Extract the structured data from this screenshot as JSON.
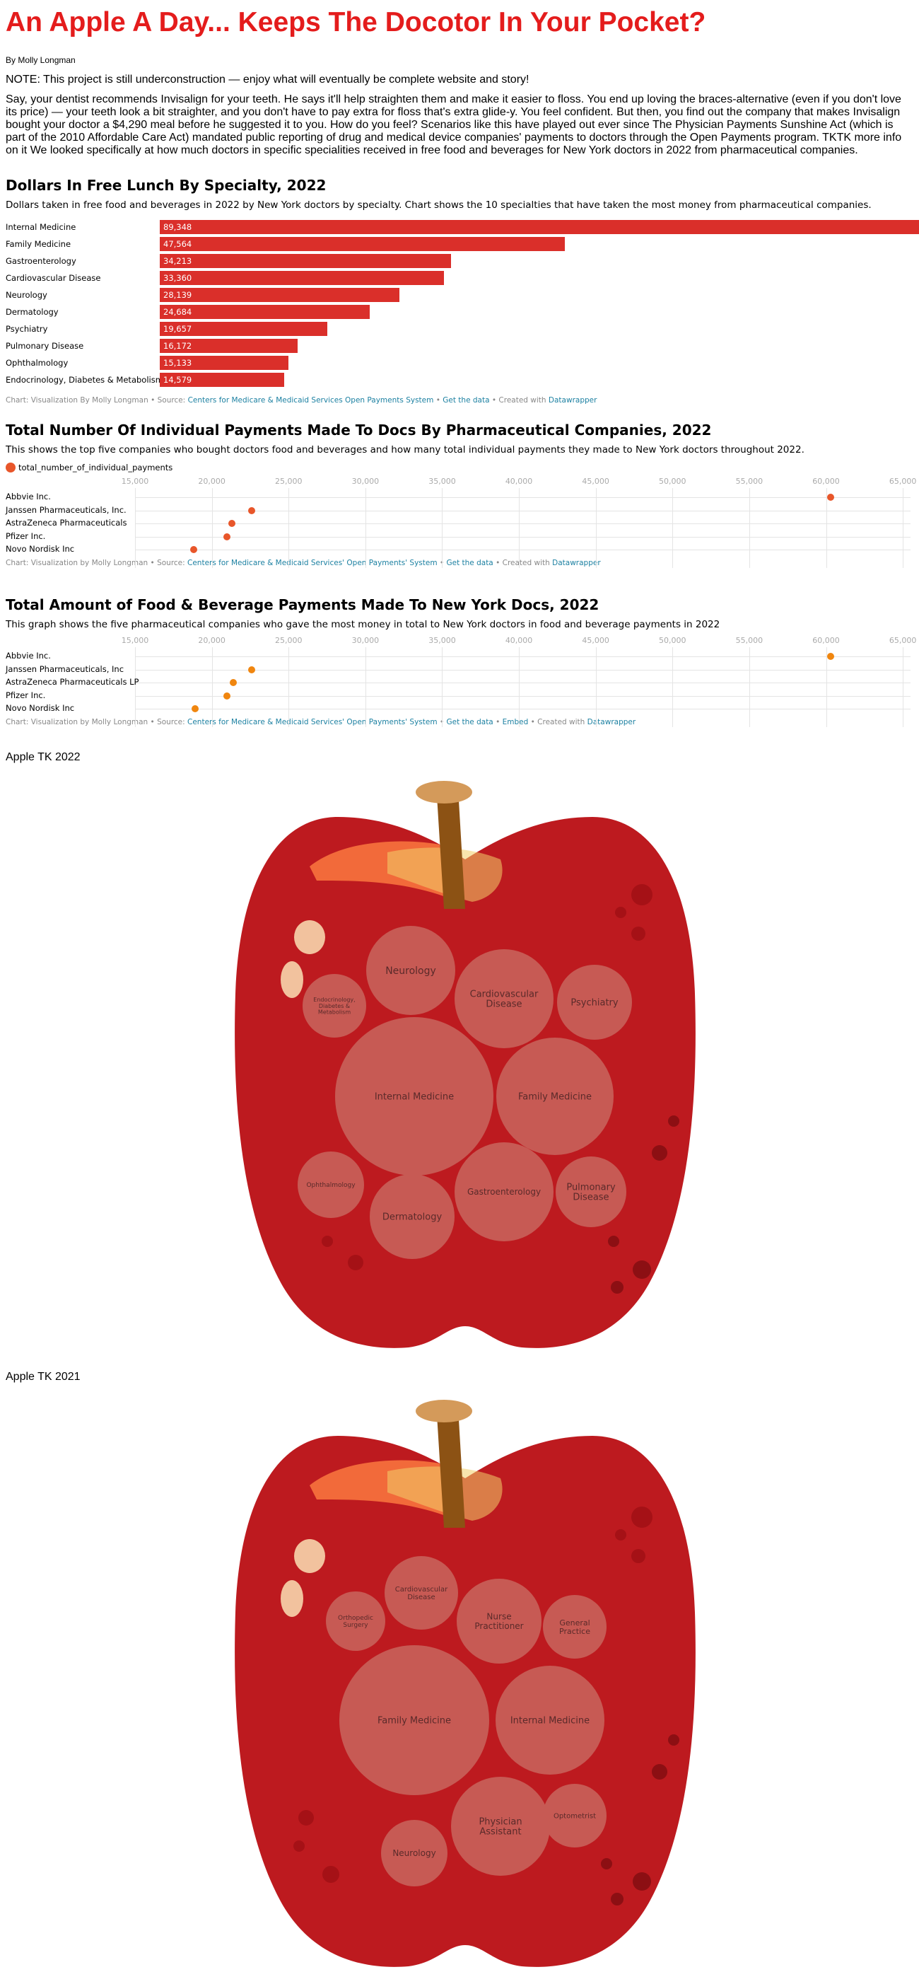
{
  "header": {
    "title": "An Apple A Day... Keeps The Docotor In Your Pocket?",
    "byline": "By Molly Longman",
    "note": "NOTE: This project is still underconstruction — enjoy what will eventually be complete website and story!",
    "intro": "Say, your dentist recommends Invisalign for your teeth. He says it'll help straighten them and make it easier to floss. You end up loving the braces-alternative (even if you don't love its price) — your teeth look a bit straighter, and you don't have to pay extra for floss that's extra glide-y. You feel confident. But then, you find out the company that makes Invisalign bought your doctor a $4,290 meal before he suggested it to you. How do you feel? Scenarios like this have played out ever since The Physician Payments Sunshine Act (which is part of the 2010 Affordable Care Act) mandated public reporting of drug and medical device companies' payments to doctors through the Open Payments program. TKTK more info on it We looked specifically at how much doctors in specific specialities received in free food and beverages for New York doctors in 2022 from pharmaceutical companies."
  },
  "colors": {
    "title_red": "#e41c1c",
    "bar_red": "#da2f2a",
    "dot_orange_red": "#e8562a",
    "dot_orange": "#f0860f",
    "link_blue": "#1d81a2",
    "apple_red": "#bd1a1f",
    "bubble": "#c75a54"
  },
  "chart_data": [
    {
      "type": "bar",
      "title": "Dollars In Free Lunch By Specialty, 2022",
      "subtitle": "Dollars taken in free food and beverages in 2022 by New York doctors by specialty. Chart shows the 10 specialties that have taken the most money from pharmaceutical companies.",
      "categories": [
        "Internal Medicine",
        "Family Medicine",
        "Gastroenterology",
        "Cardiovascular Disease",
        "Neurology",
        "Dermatology",
        "Psychiatry",
        "Pulmonary Disease",
        "Ophthalmology",
        "Endocrinology, Diabetes & Metabolism"
      ],
      "values": [
        89348,
        47564,
        34213,
        33360,
        28139,
        24684,
        19657,
        16172,
        15133,
        14579
      ],
      "value_labels": [
        "89,348",
        "47,564",
        "34,213",
        "33,360",
        "28,139",
        "24,684",
        "19,657",
        "16,172",
        "15,133",
        "14,579"
      ],
      "footer": {
        "prefix": "Chart: Visualization By Molly Longman • Source: ",
        "source": "Centers for Medicare & Medicaid Services Open Payments System",
        "sep1": " • ",
        "get_data": "Get the data",
        "sep2": " • Created with ",
        "tool": "Datawrapper"
      }
    },
    {
      "type": "scatter",
      "title": "Total Number Of Individual Payments Made To Docs By Pharmaceutical Companies, 2022",
      "subtitle": "This shows the top five companies who bought doctors food and beverages and how many total individual payments they made to New York doctors throughout 2022.",
      "legend": "total_number_of_individual_payments",
      "categories": [
        "Abbvie Inc.",
        "Janssen Pharmaceuticals, Inc.",
        "AstraZeneca Pharmaceuticals",
        "Pfizer Inc.",
        "Novo Nordisk Inc"
      ],
      "values": [
        60300,
        22600,
        21300,
        21000,
        18800
      ],
      "xlim": [
        15000,
        65500
      ],
      "xticks": [
        "15,000",
        "20,000",
        "25,000",
        "30,000",
        "35,000",
        "40,000",
        "45,000",
        "50,000",
        "55,000",
        "60,000",
        "65,000"
      ],
      "xtick_values": [
        15000,
        20000,
        25000,
        30000,
        35000,
        40000,
        45000,
        50000,
        55000,
        60000,
        65000
      ],
      "footer": {
        "prefix": "Chart: Visualization by Molly Longman • Source: ",
        "source": "Centers for Medicare & Medicaid Services' Open Payments' System",
        "sep1": " • ",
        "get_data": "Get the data",
        "sep2": " • Created with ",
        "tool": "Datawrapper"
      }
    },
    {
      "type": "scatter",
      "title": "Total Amount of Food & Beverage Payments Made To New York Docs, 2022",
      "subtitle": "This graph shows the five pharmaceutical companies who gave the most money in total to New York doctors in food and beverage payments in 2022",
      "categories": [
        "Abbvie Inc.",
        "Janssen Pharmaceuticals, Inc",
        "AstraZeneca Pharmaceuticals LP",
        "Pfizer Inc.",
        "Novo Nordisk Inc"
      ],
      "values": [
        60300,
        22600,
        21400,
        21000,
        18900
      ],
      "xlim": [
        15000,
        65500
      ],
      "xticks": [
        "15,000",
        "20,000",
        "25,000",
        "30,000",
        "35,000",
        "40,000",
        "45,000",
        "50,000",
        "55,000",
        "60,000",
        "65,000"
      ],
      "xtick_values": [
        15000,
        20000,
        25000,
        30000,
        35000,
        40000,
        45000,
        50000,
        55000,
        60000,
        65000
      ],
      "footer": {
        "prefix": "Chart: Visualization by Molly Longman • Source: ",
        "source": "Centers for Medicare & Medicaid Services' Open Payments' System",
        "sep1": " • ",
        "get_data": "Get the data",
        "sep3": " • ",
        "embed": "Embed",
        "sep2": " • Created with ",
        "tool": "Datawrapper"
      }
    }
  ],
  "apples": [
    {
      "title": "Apple TK 2022",
      "bubbles": [
        "Neurology",
        "Cardiovascular Disease",
        "Psychiatry",
        "Endocrinology, Diabetes & Metabolism",
        "Internal Medicine",
        "Family Medicine",
        "Ophthalmology",
        "Dermatology",
        "Gastroenterology",
        "Pulmonary Disease"
      ]
    },
    {
      "title": "Apple TK 2021",
      "bubbles": [
        "Cardiovascular Disease",
        "Orthopedic Surgery",
        "Nurse Practitioner",
        "General Practice",
        "Family Medicine",
        "Internal Medicine",
        "Optometrist",
        "Physician Assistant",
        "Neurology"
      ]
    }
  ]
}
